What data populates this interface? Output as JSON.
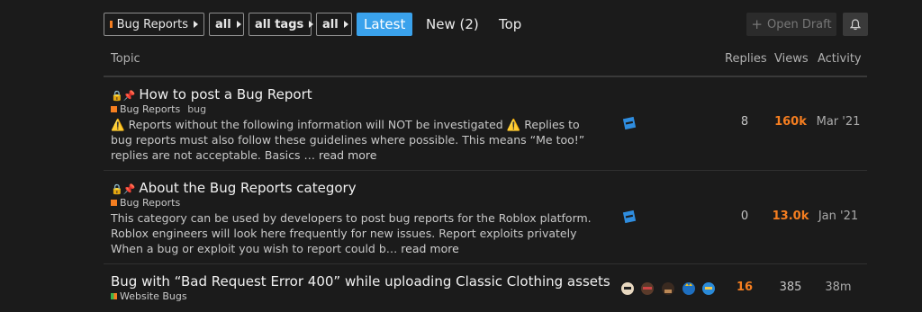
{
  "nav": {
    "category": "Bug Reports",
    "subcategory": "all",
    "tags": "all tags",
    "filter": "all",
    "latest": "Latest",
    "new": "New (2)",
    "top": "Top",
    "open_draft": "Open Draft"
  },
  "columns": {
    "topic": "Topic",
    "replies": "Replies",
    "views": "Views",
    "activity": "Activity"
  },
  "topics": [
    {
      "title": "How to post a Bug Report",
      "category": "Bug Reports",
      "tag": "bug",
      "excerpt_a": "Reports without the following information will NOT be investigated",
      "excerpt_b": "Replies to bug reports must also follow these guidelines where possible. This means “Me too!” replies are not acceptable. Basics …",
      "more": "read more",
      "replies": "8",
      "views": "160k",
      "activity": "Mar '21"
    },
    {
      "title": "About the Bug Reports category",
      "category": "Bug Reports",
      "excerpt": "This category can be used by developers to post bug reports for the Roblox platform. Roblox engineers will look here frequently for new issues. Report exploits privately When a bug or exploit you wish to report could b…",
      "more": "read more",
      "replies": "0",
      "views": "13.0k",
      "activity": "Jan '21"
    },
    {
      "title": "Bug with “Bad Request Error 400” while uploading Classic Clothing assets",
      "category": "Website Bugs",
      "replies": "16",
      "views": "385",
      "activity": "38m"
    }
  ],
  "colors": {
    "accent": "#3aa2ec",
    "category": "#f57e20",
    "hot": "#f57e20"
  }
}
